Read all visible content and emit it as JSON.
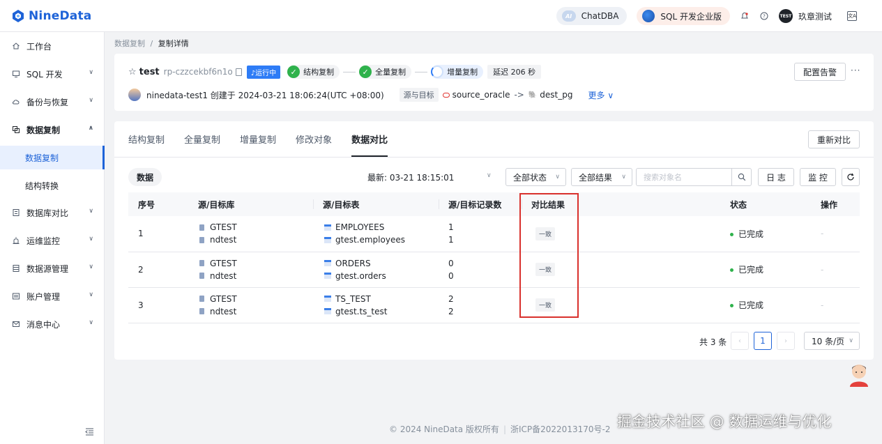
{
  "app": {
    "logo_text": "NineData"
  },
  "topbar": {
    "chatdba_badge": "AI",
    "chatdba_label": "ChatDBA",
    "sql_label": "SQL 开发企业版",
    "avatar_text": "TEST",
    "username": "玖章测试",
    "lang_glyph": "文A"
  },
  "sidebar": {
    "items": [
      {
        "label": "工作台",
        "icon": "home-icon"
      },
      {
        "label": "SQL 开发",
        "icon": "monitor-icon"
      },
      {
        "label": "备份与恢复",
        "icon": "cloud-icon"
      },
      {
        "label": "数据复制",
        "icon": "copy-icon"
      },
      {
        "label": "数据库对比",
        "icon": "compare-icon"
      },
      {
        "label": "运维监控",
        "icon": "alarm-icon"
      },
      {
        "label": "数据源管理",
        "icon": "database-icon"
      },
      {
        "label": "账户管理",
        "icon": "account-icon"
      },
      {
        "label": "消息中心",
        "icon": "mail-icon"
      }
    ],
    "sub_items": [
      "数据复制",
      "结构转换"
    ]
  },
  "breadcrumb": {
    "parent": "数据复制",
    "separator": "/",
    "current": "复制详情"
  },
  "task": {
    "name": "test",
    "id": "rp-czzcekbf6n1o",
    "status_badge": "运行中",
    "steps": [
      "结构复制",
      "全量复制",
      "增量复制"
    ],
    "delay": "延迟 206 秒",
    "alert_button": "配置告警",
    "owner": "ninedata-test1 创建于 2024-03-21 18:06:24(UTC +08:00)",
    "src_tgt_label": "源与目标",
    "source": "source_oracle",
    "arrow": "->",
    "target": "dest_pg",
    "more": "更多 ∨"
  },
  "tabs": [
    "结构复制",
    "全量复制",
    "增量复制",
    "修改对象",
    "数据对比"
  ],
  "active_tab": "数据对比",
  "recompare_button": "重新对比",
  "toolbar": {
    "data_chip": "数据",
    "latest": "最新:  03-21 18:15:01",
    "status_select": "全部状态",
    "result_select": "全部结果",
    "search_placeholder": "搜索对象名",
    "log_button": "日 志",
    "monitor_button": "监 控"
  },
  "table": {
    "headers": [
      "序号",
      "源/目标库",
      "源/目标表",
      "源/目标记录数",
      "对比结果",
      "状态",
      "操作"
    ],
    "rows": [
      {
        "no": "1",
        "src_db": "GTEST",
        "dst_db": "ndtest",
        "src_table": "EMPLOYEES",
        "dst_table": "gtest.employees",
        "src_count": "1",
        "dst_count": "1",
        "result": "一致",
        "status": "已完成",
        "op": "-"
      },
      {
        "no": "2",
        "src_db": "GTEST",
        "dst_db": "ndtest",
        "src_table": "ORDERS",
        "dst_table": "gtest.orders",
        "src_count": "0",
        "dst_count": "0",
        "result": "一致",
        "status": "已完成",
        "op": "-"
      },
      {
        "no": "3",
        "src_db": "GTEST",
        "dst_db": "ndtest",
        "src_table": "TS_TEST",
        "dst_table": "gtest.ts_test",
        "src_count": "2",
        "dst_count": "2",
        "result": "一致",
        "status": "已完成",
        "op": "-"
      }
    ]
  },
  "pagination": {
    "total": "共 3 条",
    "current": "1",
    "page_size": "10 条/页"
  },
  "footer": {
    "copyright": "© 2024 NineData 版权所有",
    "icp": "浙ICP备2022013170号-2"
  },
  "watermark": "掘金技术社区 @ 数据运维与优化",
  "colors": {
    "brand": "#1e63d8",
    "success": "#2fb24c",
    "highlight_box": "#d9302c"
  }
}
